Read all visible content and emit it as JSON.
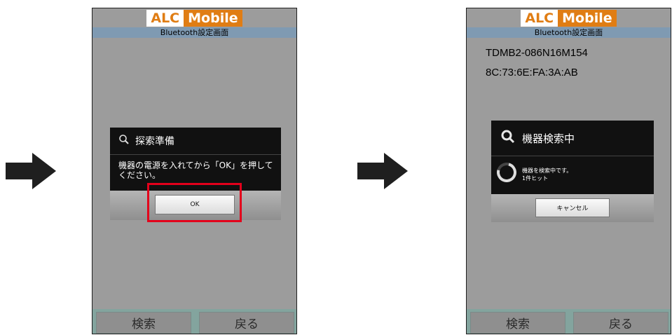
{
  "logo": {
    "part1": "ALC",
    "part2": "Mobile"
  },
  "screen_title": "Bluetooth設定画面",
  "left_phone": {
    "dialog": {
      "title": "探索準備",
      "message": "機器の電源を入れてから「OK」を押してください。",
      "ok_label": "OK"
    },
    "footer": {
      "search_label": "検索",
      "back_label": "戻る"
    }
  },
  "right_phone": {
    "device_name": "TDMB2-086N16M154",
    "device_address": "8C:73:6E:FA:3A:AB",
    "dialog": {
      "title": "機器検索中",
      "status_line1": "機器を検索中です。",
      "status_line2": "1件ヒット",
      "cancel_label": "キャンセル"
    },
    "footer": {
      "search_label": "検索",
      "back_label": "戻る"
    }
  },
  "colors": {
    "brand_orange": "#e07d14",
    "title_bar": "#7f9ab2",
    "highlight_red": "#e3001b",
    "footer_green": "#83a49e"
  },
  "icons": [
    "arrow-right-icon",
    "search-icon",
    "spinner-icon"
  ]
}
